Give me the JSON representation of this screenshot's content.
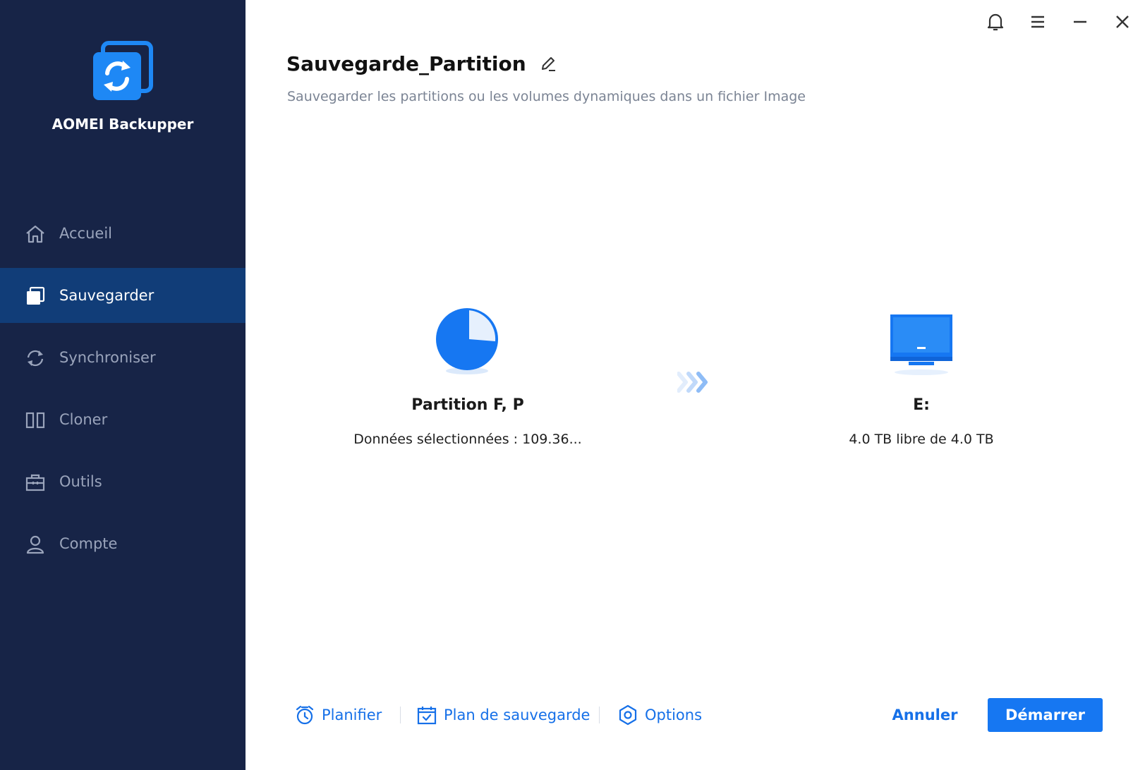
{
  "app": {
    "name": "AOMEI Backupper"
  },
  "sidebar": {
    "items": [
      {
        "label": "Accueil",
        "icon": "home-icon",
        "active": false
      },
      {
        "label": "Sauvegarder",
        "icon": "backup-icon",
        "active": true
      },
      {
        "label": "Synchroniser",
        "icon": "sync-icon",
        "active": false
      },
      {
        "label": "Cloner",
        "icon": "clone-icon",
        "active": false
      },
      {
        "label": "Outils",
        "icon": "toolbox-icon",
        "active": false
      },
      {
        "label": "Compte",
        "icon": "user-icon",
        "active": false
      }
    ]
  },
  "window_controls": [
    "bell-icon",
    "menu-icon",
    "minimize-icon",
    "close-icon"
  ],
  "page": {
    "title": "Sauvegarde_Partition",
    "subtitle": "Sauvegarder les partitions ou les volumes dynamiques dans un fichier Image"
  },
  "source": {
    "name": "Partition F, P",
    "info": "Données sélectionnées : 109.36..."
  },
  "destination": {
    "name": "E:",
    "info": "4.0 TB libre de 4.0 TB"
  },
  "footer": {
    "schedule_label": "Planifier",
    "plan_label": "Plan de sauvegarde",
    "options_label": "Options",
    "cancel_label": "Annuler",
    "start_label": "Démarrer"
  },
  "colors": {
    "sidebar_bg": "#172447",
    "sidebar_active": "#113d78",
    "accent": "#1677f2",
    "link": "#1670e8"
  }
}
